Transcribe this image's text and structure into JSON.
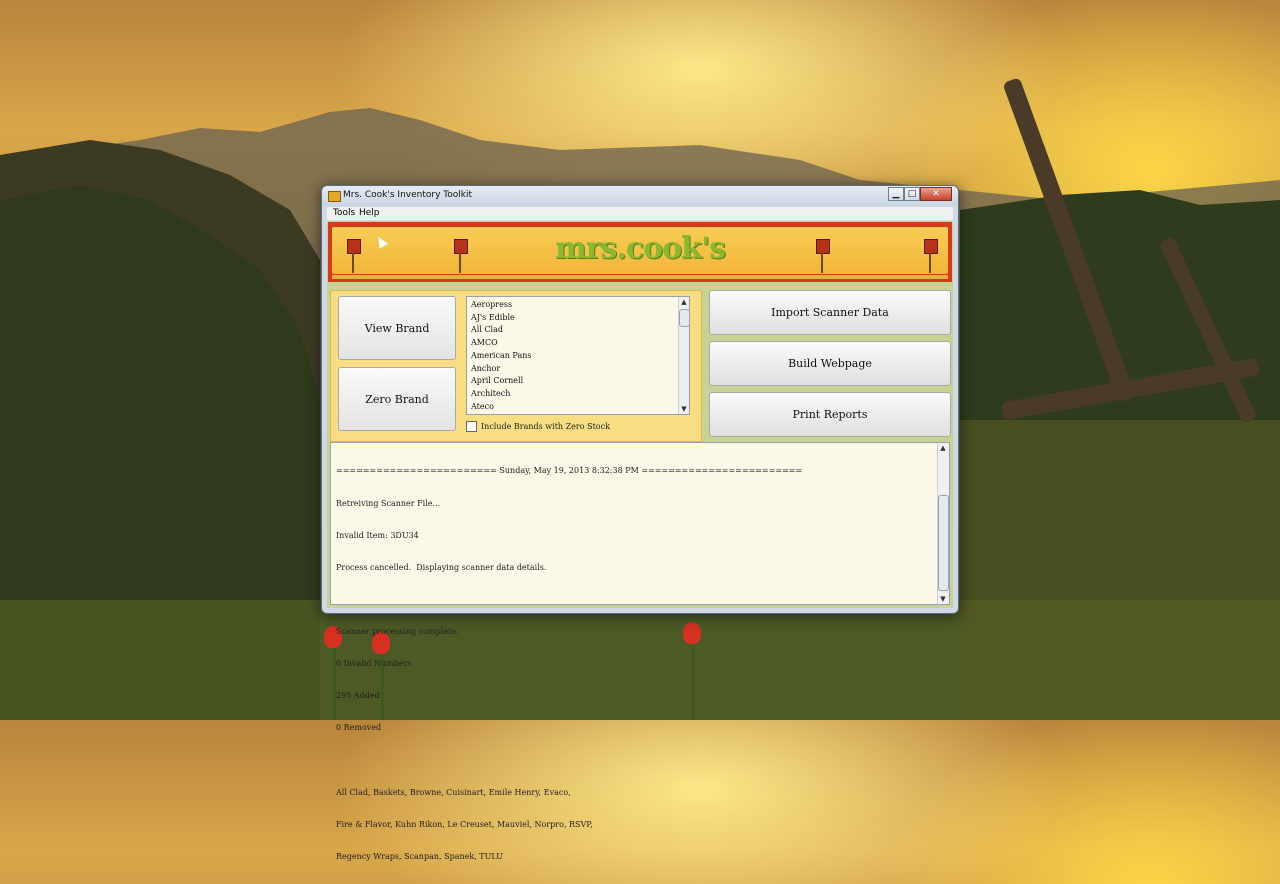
{
  "window": {
    "title": "Mrs. Cook's Inventory Toolkit"
  },
  "menu": {
    "items": [
      "Tools",
      "Help"
    ]
  },
  "banner": {
    "logo": "mrs.cook's"
  },
  "buttons": {
    "view_brand": "View Brand",
    "zero_brand": "Zero Brand",
    "import_scanner": "Import Scanner Data",
    "build_webpage": "Build Webpage",
    "print_reports": "Print Reports"
  },
  "brands": [
    "Aeropress",
    "AJ's Edible",
    "All Clad",
    "AMCO",
    "American Pans",
    "Anchor",
    "April Cornell",
    "Architech",
    "Ateco"
  ],
  "zero_stock": {
    "label": "Include Brands with Zero Stock",
    "checked": false
  },
  "log": {
    "lines": [
      "======================== Sunday, May 19, 2013 8:32:38 PM ========================",
      "Retreiving Scanner File...",
      "Invalid Item: 3DU34",
      "Process cancelled.  Displaying scanner data details.",
      "",
      "Scanner processing complete.",
      "0 Invalid Numbers",
      "295 Added",
      "0 Removed",
      "",
      "All Clad, Baskets, Browne, Cuisinart, Emile Henry, Evaco,",
      "Fire & Flavor, Kuhn Rikon, Le Creuset, Mauviel, Norpro, RSVP,",
      "Regency Wraps, Scanpan, Spanek, TULU"
    ]
  },
  "colors": {
    "banner_red": "#d53a1a",
    "banner_gold": "#f2b638",
    "panel_yellow": "#f9dd82",
    "logo_green": "#8ab82e"
  }
}
